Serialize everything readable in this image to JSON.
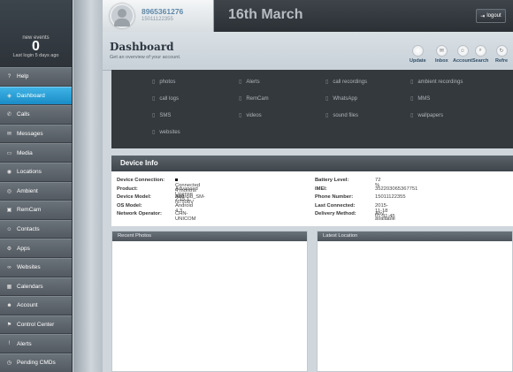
{
  "sidebar": {
    "events_label": "new events",
    "events_count": "0",
    "last_login": "Last login 5 days ago",
    "items": [
      {
        "label": "Help",
        "icon": "help-icon",
        "glyph": "?"
      },
      {
        "label": "Dashboard",
        "icon": "dashboard-icon",
        "glyph": "◈"
      },
      {
        "label": "Calls",
        "icon": "phone-icon",
        "glyph": "✆"
      },
      {
        "label": "Messages",
        "icon": "message-icon",
        "glyph": "✉"
      },
      {
        "label": "Media",
        "icon": "media-icon",
        "glyph": "▭"
      },
      {
        "label": "Locations",
        "icon": "location-icon",
        "glyph": "◉"
      },
      {
        "label": "Ambient",
        "icon": "ambient-icon",
        "glyph": "◎"
      },
      {
        "label": "RemCam",
        "icon": "camera-icon",
        "glyph": "▣"
      },
      {
        "label": "Contacts",
        "icon": "contacts-icon",
        "glyph": "☺"
      },
      {
        "label": "Apps",
        "icon": "apps-icon",
        "glyph": "⚙"
      },
      {
        "label": "Websites",
        "icon": "link-icon",
        "glyph": "∞"
      },
      {
        "label": "Calendars",
        "icon": "calendar-icon",
        "glyph": "▦"
      },
      {
        "label": "Account",
        "icon": "account-icon",
        "glyph": "☻"
      },
      {
        "label": "Control Center",
        "icon": "control-icon",
        "glyph": "⚑"
      },
      {
        "label": "Alerts",
        "icon": "alert-icon",
        "glyph": "!"
      },
      {
        "label": "Pending CMDs",
        "icon": "pending-icon",
        "glyph": "◷"
      }
    ],
    "active_item": "Dashboard"
  },
  "header": {
    "number": "8965361276",
    "sub_number": "15011122355",
    "date_title": "16th March",
    "logout_label": "logout"
  },
  "titlebar": {
    "title": "Dashboard",
    "subtitle": "Get an overview of your account.",
    "actions": [
      {
        "label": "Update",
        "icon": "update-icon",
        "glyph": " "
      },
      {
        "label": "Inbox",
        "icon": "inbox-icon",
        "glyph": "✉"
      },
      {
        "label": "Account",
        "icon": "account-icon",
        "glyph": "☺"
      },
      {
        "label": "Search",
        "icon": "search-icon",
        "glyph": "⌕"
      },
      {
        "label": "Refre",
        "icon": "refresh-icon",
        "glyph": "↻"
      }
    ]
  },
  "apps": [
    "photos",
    "Alerts",
    "call recordings",
    "ambient recordings",
    "call logs",
    "RemCam",
    "WhatsApp",
    "MMS",
    "SMS",
    "videos",
    "sound files",
    "wallpapers",
    "websites"
  ],
  "device": {
    "heading": "Device Info",
    "left": [
      {
        "k": "Device Connection:",
        "v": "Connected 4 months ago",
        "status": true
      },
      {
        "k": "Product:",
        "v": "Advanced License 2.15.1"
      },
      {
        "k": "Device Model:",
        "v": "Android_SM-N7508V"
      },
      {
        "k": "OS Model:",
        "v": "Android 4.3"
      },
      {
        "k": "Network Operator:",
        "v": "CHN-UNICOM"
      }
    ],
    "right": [
      {
        "k": "Battery Level:",
        "v": "72 %"
      },
      {
        "k": "IMEI:",
        "v": "352203065367751"
      },
      {
        "k": "Phone Number:",
        "v": "15011122355"
      },
      {
        "k": "Last Connected:",
        "v": "2015-11-18 01:31:45"
      },
      {
        "k": "Delivery Method:",
        "v": "Any available"
      }
    ]
  },
  "panels": {
    "recent_photos": "Recent Photos",
    "latest_location": "Latest Location"
  },
  "colors": {
    "accent": "#1a8cc6",
    "apps_bg": "#34393e",
    "header_bg": "#2b3035"
  }
}
